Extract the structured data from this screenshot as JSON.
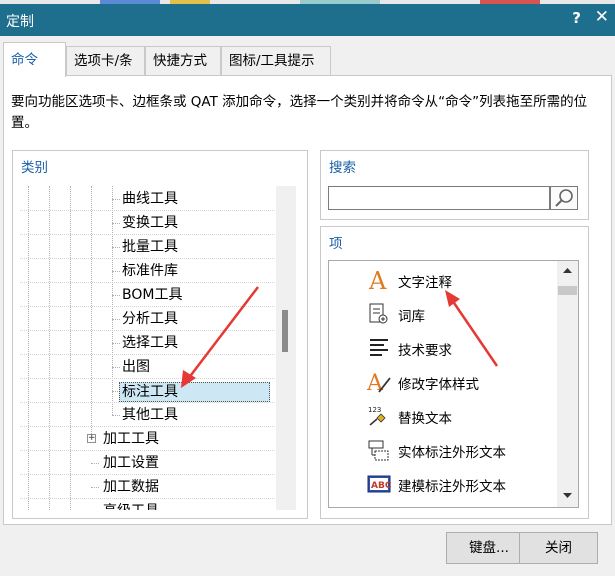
{
  "window": {
    "title": "定制",
    "help_label": "?",
    "close_label": "✕"
  },
  "tabs": [
    {
      "label": "命令",
      "active": true
    },
    {
      "label": "选项卡/条",
      "active": false
    },
    {
      "label": "快捷方式",
      "active": false
    },
    {
      "label": "图标/工具提示",
      "active": false
    }
  ],
  "description": "要向功能区选项卡、边框条或 QAT 添加命令，选择一个类别并将命令从“命令”列表拖至所需的位置。",
  "categories": {
    "title": "类别",
    "items": [
      {
        "label": "曲线工具",
        "level": 2
      },
      {
        "label": "变换工具",
        "level": 2
      },
      {
        "label": "批量工具",
        "level": 2
      },
      {
        "label": "标准件库",
        "level": 2
      },
      {
        "label": "BOM工具",
        "level": 2
      },
      {
        "label": "分析工具",
        "level": 2
      },
      {
        "label": "选择工具",
        "level": 2
      },
      {
        "label": "出图",
        "level": 2
      },
      {
        "label": "标注工具",
        "level": 2,
        "selected": true
      },
      {
        "label": "其他工具",
        "level": 2
      },
      {
        "label": "加工工具",
        "level": 1,
        "expander": "+"
      },
      {
        "label": "加工设置",
        "level": 1
      },
      {
        "label": "加工数据",
        "level": 1
      },
      {
        "label": "高级工具",
        "level": 1
      }
    ]
  },
  "search": {
    "title": "搜索",
    "value": "",
    "icon": "magnifier-icon"
  },
  "commands": {
    "title": "项",
    "items": [
      {
        "label": "文字注释",
        "icon": "text-annotation-icon"
      },
      {
        "label": "词库",
        "icon": "glossary-icon"
      },
      {
        "label": "技术要求",
        "icon": "technical-requirements-icon"
      },
      {
        "label": "修改字体样式",
        "icon": "edit-font-style-icon"
      },
      {
        "label": "替换文本",
        "icon": "replace-text-icon"
      },
      {
        "label": "实体标注外形文本",
        "icon": "solid-outline-text-icon"
      },
      {
        "label": "建模标注外形文本",
        "icon": "model-outline-text-icon"
      },
      {
        "label": "",
        "icon": "text-annotation-icon"
      }
    ]
  },
  "buttons": {
    "keyboard": "键盘...",
    "close": "关闭"
  },
  "colors": {
    "titlebar": "#1e6e8e",
    "tab_active_text": "#1a5fa8",
    "selection": "#cde8f4",
    "annotation_arrow": "#e53935",
    "icon_orange": "#e07a1f"
  }
}
